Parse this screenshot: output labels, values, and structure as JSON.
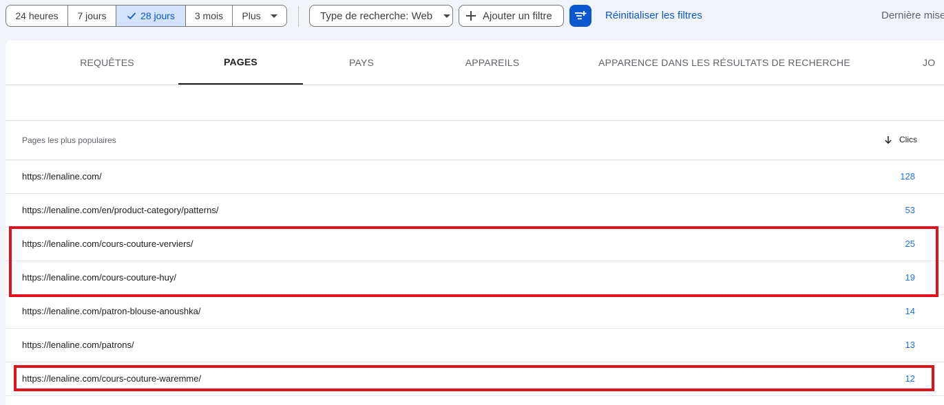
{
  "filters": {
    "date_ranges": [
      {
        "label": "24 heures",
        "selected": false
      },
      {
        "label": "7 jours",
        "selected": false
      },
      {
        "label": "28 jours",
        "selected": true
      },
      {
        "label": "3 mois",
        "selected": false
      },
      {
        "label": "Plus",
        "selected": false
      }
    ],
    "search_type_label": "Type de recherche: Web",
    "add_filter_label": "Ajouter un filtre",
    "reset_label": "Réinitialiser les filtres",
    "last_update_label": "Dernière mise"
  },
  "tabs": [
    {
      "label": "REQUÊTES",
      "active": false
    },
    {
      "label": "PAGES",
      "active": true
    },
    {
      "label": "PAYS",
      "active": false
    },
    {
      "label": "APPAREILS",
      "active": false
    },
    {
      "label": "APPARENCE DANS LES RÉSULTATS DE RECHERCHE",
      "active": false
    },
    {
      "label": "JO",
      "active": false
    }
  ],
  "table": {
    "column_pages": "Pages les plus populaires",
    "column_clics": "Clics",
    "rows": [
      {
        "url": "https://lenaline.com/",
        "clics": "128"
      },
      {
        "url": "https://lenaline.com/en/product-category/patterns/",
        "clics": "53"
      },
      {
        "url": "https://lenaline.com/cours-couture-verviers/",
        "clics": "25"
      },
      {
        "url": "https://lenaline.com/cours-couture-huy/",
        "clics": "19"
      },
      {
        "url": "https://lenaline.com/patron-blouse-anoushka/",
        "clics": "14"
      },
      {
        "url": "https://lenaline.com/patrons/",
        "clics": "13"
      },
      {
        "url": "https://lenaline.com/cours-couture-waremme/",
        "clics": "12"
      }
    ]
  },
  "colors": {
    "accent": "#0b57d0",
    "selected_bg": "#d3e3fd",
    "link_value": "#1a73e8",
    "highlight": "#e0131c",
    "page_bg": "#f0f3f8"
  },
  "icons": {
    "check": "check-icon",
    "dropdown": "caret-down-icon",
    "add": "plus-icon",
    "filter": "filter-settings-icon",
    "sort": "arrow-down-icon"
  }
}
